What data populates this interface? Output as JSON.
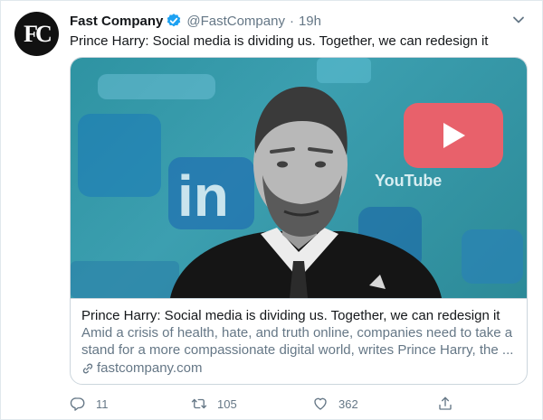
{
  "account": {
    "avatar_text": "FC",
    "name": "Fast Company",
    "handle": "@FastCompany",
    "separator": "·",
    "time": "19h"
  },
  "tweet": {
    "text": "Prince Harry: Social media is dividing us. Together, we can redesign it"
  },
  "card": {
    "image_text": "YouTube",
    "title": "Prince Harry: Social media is dividing us. Together, we can redesign it",
    "description": "Amid a crisis of health, hate, and truth online, companies need to take a stand for a more compassionate digital world, writes Prince Harry, the ...",
    "domain": "fastcompany.com"
  },
  "actions": {
    "replies": "11",
    "retweets": "105",
    "likes": "362"
  },
  "colors": {
    "verified": "#1da1f2",
    "muted": "#657786",
    "image_bg": "#2e93a2",
    "youtube_icon": "#e8616b"
  },
  "icons": [
    "verified-badge-icon",
    "chevron-down-icon",
    "link-icon",
    "reply-icon",
    "retweet-icon",
    "like-icon",
    "share-icon"
  ]
}
